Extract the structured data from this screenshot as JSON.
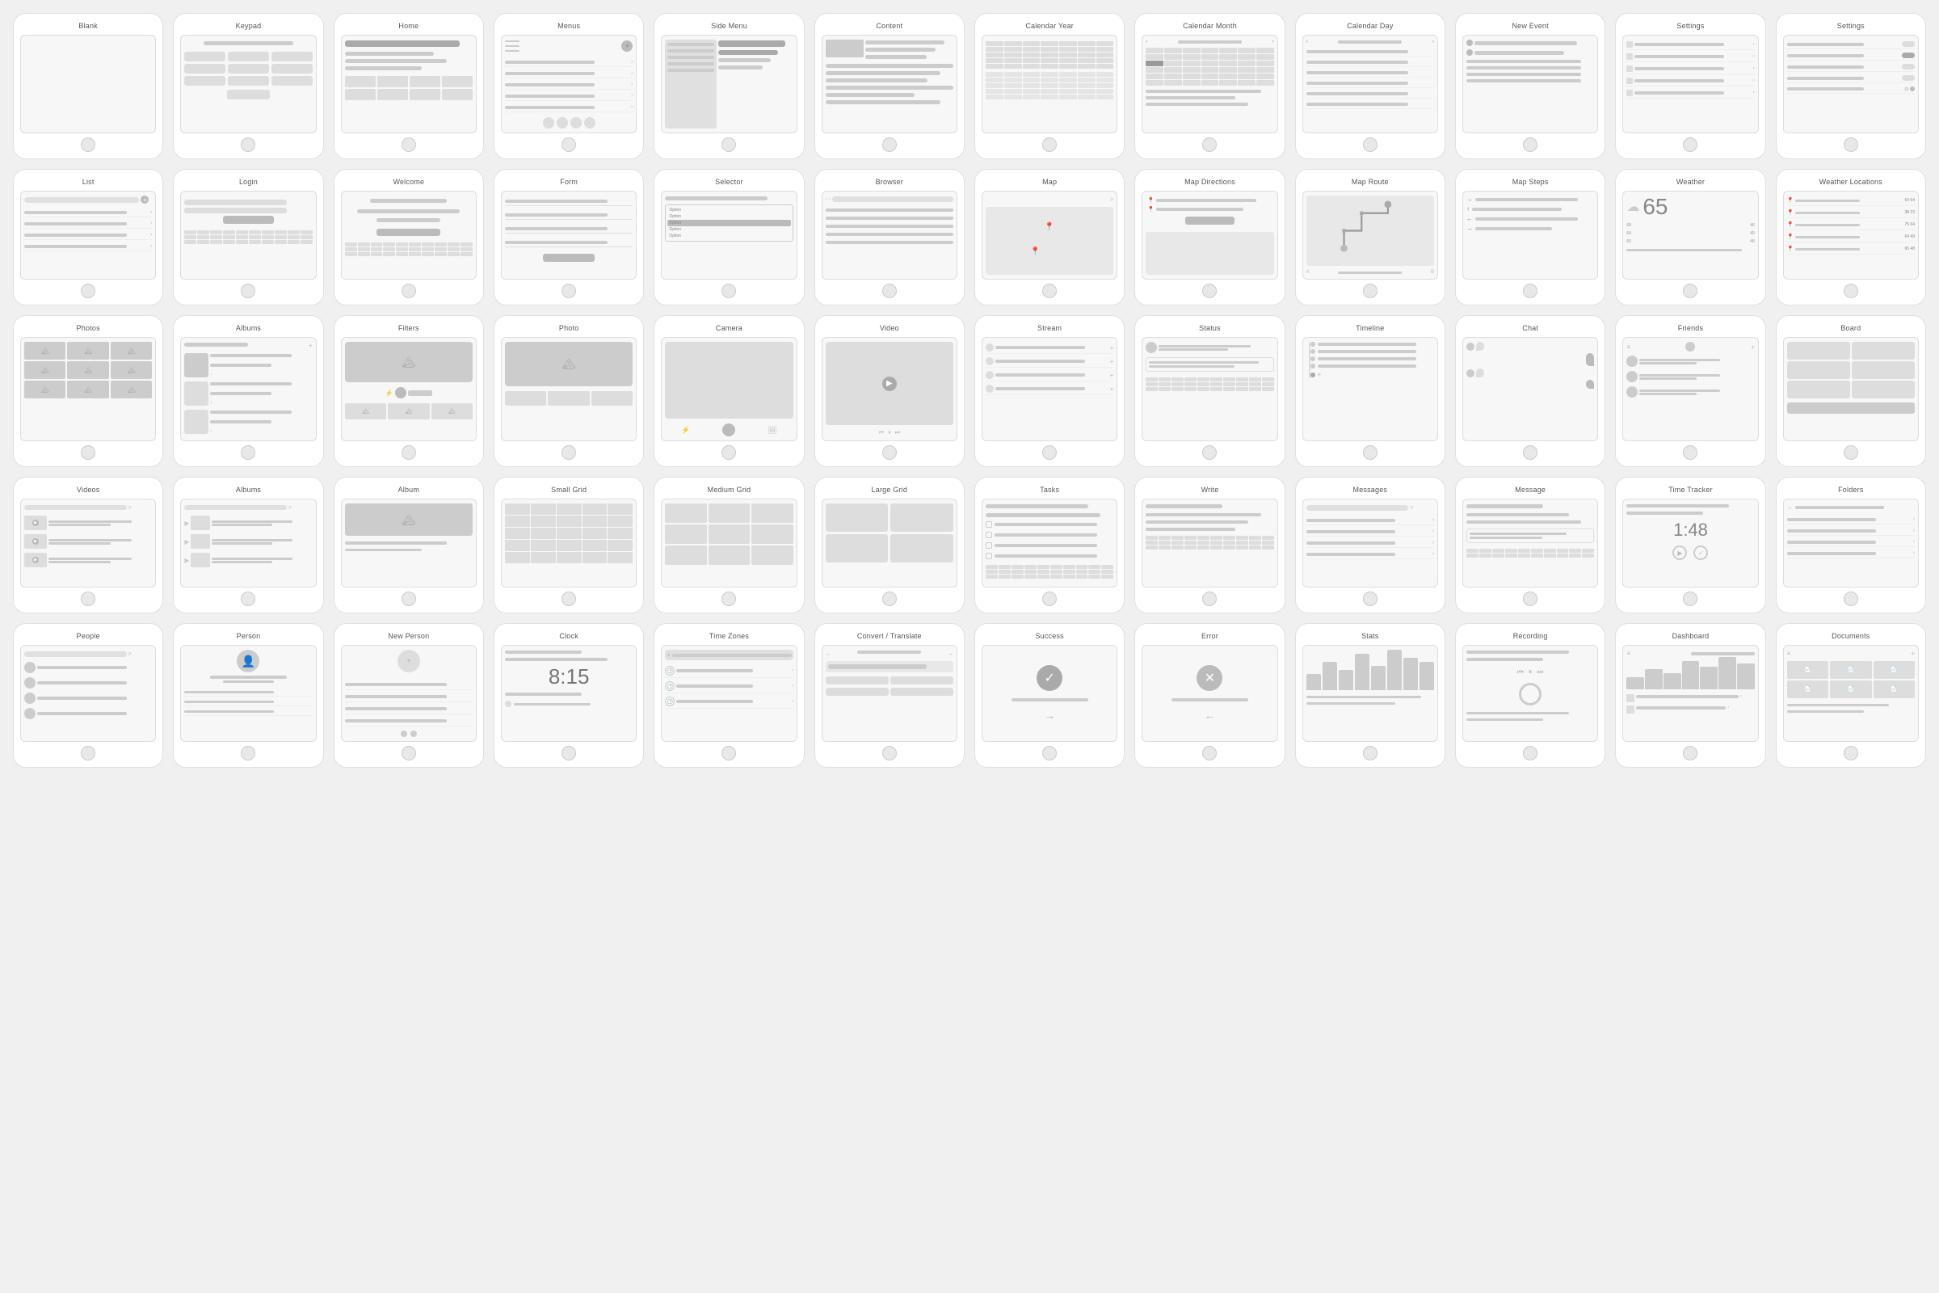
{
  "rows": [
    {
      "cards": [
        {
          "id": "blank",
          "title": "Blank",
          "type": "blank"
        },
        {
          "id": "keypad",
          "title": "Keypad",
          "type": "keypad"
        },
        {
          "id": "home",
          "title": "Home",
          "type": "home"
        },
        {
          "id": "menus",
          "title": "Menus",
          "type": "menus"
        },
        {
          "id": "side-menu",
          "title": "Side Menu",
          "type": "side-menu"
        },
        {
          "id": "content",
          "title": "Content",
          "type": "content"
        },
        {
          "id": "calendar-year",
          "title": "Calendar Year",
          "type": "calendar-year"
        },
        {
          "id": "calendar-month",
          "title": "Calendar Month",
          "type": "calendar-month"
        },
        {
          "id": "calendar-day",
          "title": "Calendar Day",
          "type": "calendar-day"
        },
        {
          "id": "new-event",
          "title": "New Event",
          "type": "new-event"
        },
        {
          "id": "settings1",
          "title": "Settings",
          "type": "settings1"
        },
        {
          "id": "settings2",
          "title": "Settings",
          "type": "settings2"
        }
      ]
    },
    {
      "cards": [
        {
          "id": "list",
          "title": "List",
          "type": "list"
        },
        {
          "id": "login",
          "title": "Login",
          "type": "login"
        },
        {
          "id": "welcome",
          "title": "Welcome",
          "type": "welcome"
        },
        {
          "id": "form",
          "title": "Form",
          "type": "form"
        },
        {
          "id": "selector",
          "title": "Selector",
          "type": "selector"
        },
        {
          "id": "browser",
          "title": "Browser",
          "type": "browser"
        },
        {
          "id": "map",
          "title": "Map",
          "type": "map"
        },
        {
          "id": "map-directions",
          "title": "Map Directions",
          "type": "map-directions"
        },
        {
          "id": "map-route",
          "title": "Map Route",
          "type": "map-route"
        },
        {
          "id": "map-steps",
          "title": "Map Steps",
          "type": "map-steps"
        },
        {
          "id": "weather",
          "title": "Weather",
          "type": "weather"
        },
        {
          "id": "weather-locations",
          "title": "Weather Locations",
          "type": "weather-locations"
        }
      ]
    },
    {
      "cards": [
        {
          "id": "photos",
          "title": "Photos",
          "type": "photos"
        },
        {
          "id": "albums",
          "title": "Albums",
          "type": "albums"
        },
        {
          "id": "filters",
          "title": "Filters",
          "type": "filters"
        },
        {
          "id": "photo",
          "title": "Photo",
          "type": "photo"
        },
        {
          "id": "camera",
          "title": "Camera",
          "type": "camera"
        },
        {
          "id": "video",
          "title": "Video",
          "type": "video"
        },
        {
          "id": "stream",
          "title": "Stream",
          "type": "stream"
        },
        {
          "id": "status",
          "title": "Status",
          "type": "status"
        },
        {
          "id": "timeline",
          "title": "Timeline",
          "type": "timeline"
        },
        {
          "id": "chat",
          "title": "Chat",
          "type": "chat"
        },
        {
          "id": "friends",
          "title": "Friends",
          "type": "friends"
        },
        {
          "id": "board",
          "title": "Board",
          "type": "board"
        }
      ]
    },
    {
      "cards": [
        {
          "id": "videos",
          "title": "Videos",
          "type": "videos"
        },
        {
          "id": "albums2",
          "title": "Albums",
          "type": "albums2"
        },
        {
          "id": "album",
          "title": "Album",
          "type": "album"
        },
        {
          "id": "small-grid",
          "title": "Small Grid",
          "type": "small-grid"
        },
        {
          "id": "medium-grid",
          "title": "Medium Grid",
          "type": "medium-grid"
        },
        {
          "id": "large-grid",
          "title": "Large Grid",
          "type": "large-grid"
        },
        {
          "id": "tasks",
          "title": "Tasks",
          "type": "tasks"
        },
        {
          "id": "write",
          "title": "Write",
          "type": "write"
        },
        {
          "id": "messages",
          "title": "Messages",
          "type": "messages"
        },
        {
          "id": "message",
          "title": "Message",
          "type": "message"
        },
        {
          "id": "time-tracker",
          "title": "Time Tracker",
          "type": "time-tracker"
        },
        {
          "id": "folders",
          "title": "Folders",
          "type": "folders"
        }
      ]
    },
    {
      "cards": [
        {
          "id": "people",
          "title": "People",
          "type": "people"
        },
        {
          "id": "person",
          "title": "Person",
          "type": "person"
        },
        {
          "id": "new-person",
          "title": "New Person",
          "type": "new-person"
        },
        {
          "id": "clock",
          "title": "Clock",
          "type": "clock"
        },
        {
          "id": "time-zones",
          "title": "Time Zones",
          "type": "time-zones"
        },
        {
          "id": "convert-translate",
          "title": "Convert / Translate",
          "type": "convert-translate"
        },
        {
          "id": "success",
          "title": "Success",
          "type": "success"
        },
        {
          "id": "error",
          "title": "Error",
          "type": "error"
        },
        {
          "id": "stats",
          "title": "Stats",
          "type": "stats"
        },
        {
          "id": "recording",
          "title": "Recording",
          "type": "recording"
        },
        {
          "id": "dashboard",
          "title": "Dashboard",
          "type": "dashboard"
        },
        {
          "id": "documents",
          "title": "Documents",
          "type": "documents"
        }
      ]
    }
  ]
}
